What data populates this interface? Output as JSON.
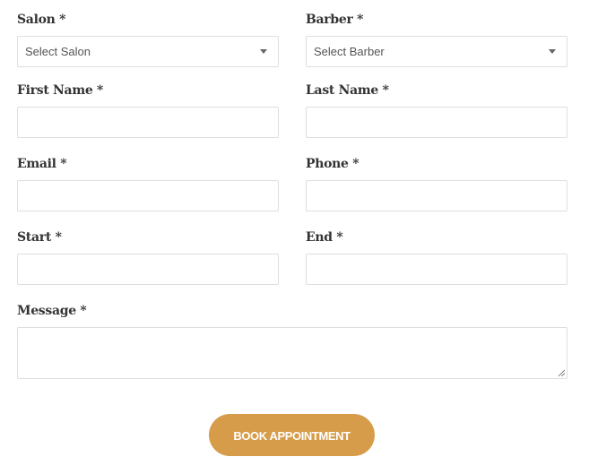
{
  "form": {
    "salon": {
      "label": "Salon *",
      "selected": "Select Salon"
    },
    "barber": {
      "label": "Barber *",
      "selected": "Select Barber"
    },
    "first_name": {
      "label": "First Name *",
      "value": ""
    },
    "last_name": {
      "label": "Last Name *",
      "value": ""
    },
    "email": {
      "label": "Email *",
      "value": ""
    },
    "phone": {
      "label": "Phone *",
      "value": ""
    },
    "start": {
      "label": "Start *",
      "value": ""
    },
    "end": {
      "label": "End *",
      "value": ""
    },
    "message": {
      "label": "Message *",
      "value": ""
    },
    "submit_label": "BOOK APPOINTMENT"
  },
  "colors": {
    "accent": "#d69c4a",
    "label_text": "#333333",
    "field_border": "#dedede"
  }
}
